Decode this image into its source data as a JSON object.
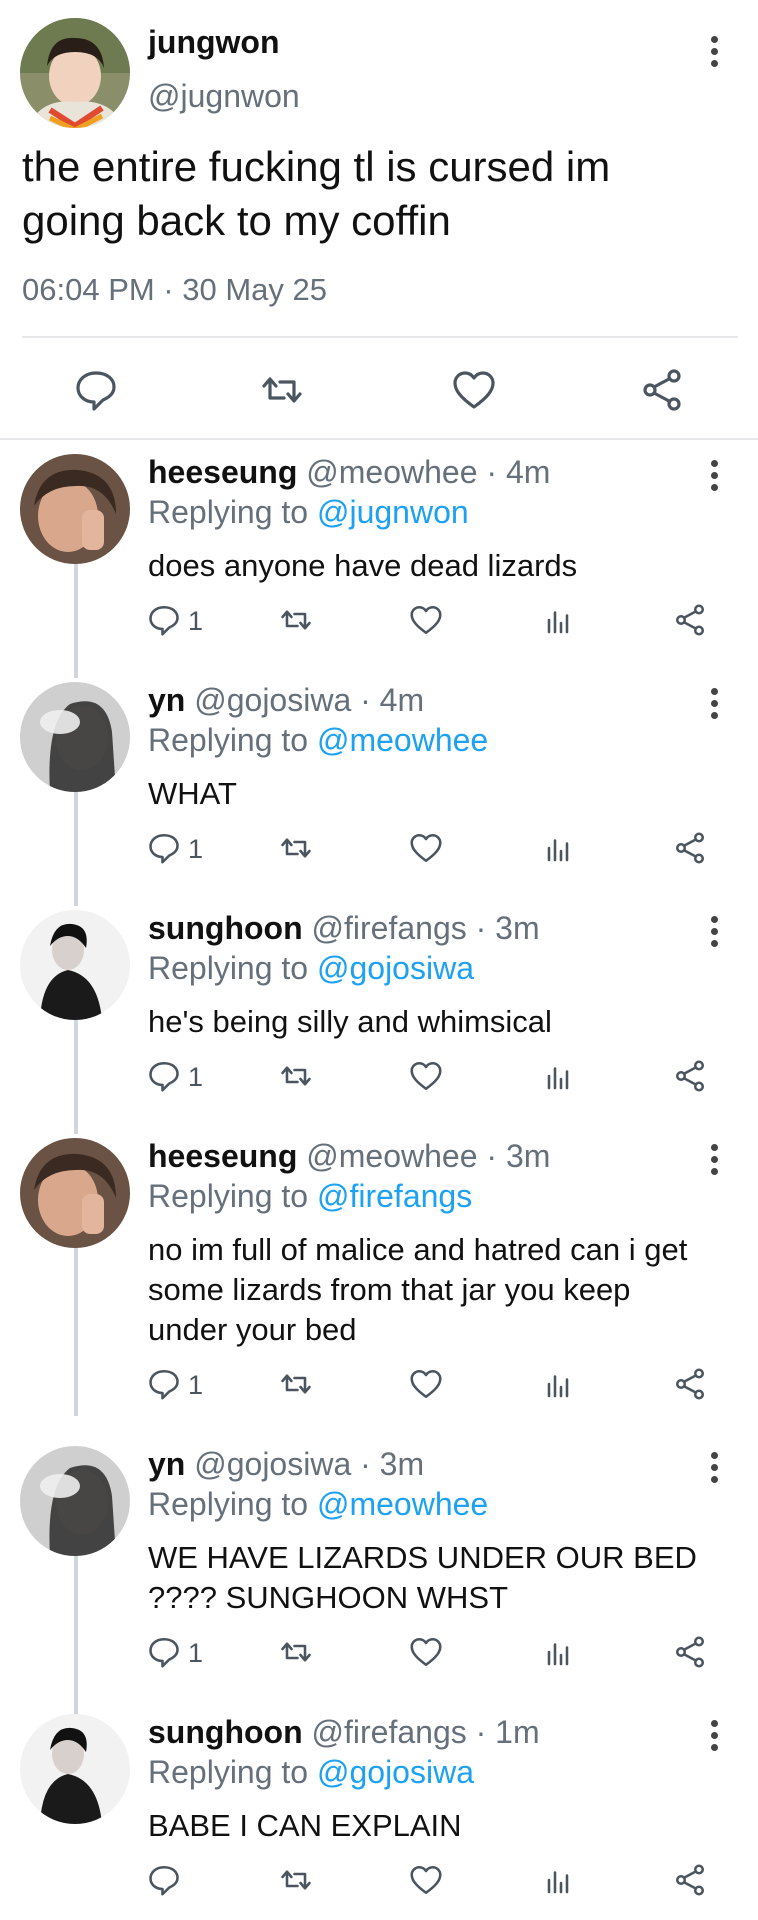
{
  "main_tweet": {
    "name": "jungwon",
    "handle": "@jugnwon",
    "text": "the entire fucking tl is cursed im going back to my coffin",
    "timestamp": "06:04 PM · 30 May 25",
    "actions": [
      "reply-icon",
      "retweet-icon",
      "like-icon",
      "share-icon"
    ]
  },
  "replies": [
    {
      "name": "heeseung",
      "handle": "@meowhee",
      "time": "· 4m",
      "replying_label": "Replying to",
      "replying_to": "@jugnwon",
      "text": "does anyone have dead lizards",
      "reply_count": "1"
    },
    {
      "name": "yn",
      "handle": "@gojosiwa",
      "time": "· 4m",
      "replying_label": "Replying to",
      "replying_to": "@meowhee",
      "text": "WHAT",
      "reply_count": "1"
    },
    {
      "name": "sunghoon",
      "handle": "@firefangs",
      "time": "· 3m",
      "replying_label": "Replying to",
      "replying_to": "@gojosiwa",
      "text": "he's being silly and whimsical",
      "reply_count": "1"
    },
    {
      "name": "heeseung",
      "handle": "@meowhee",
      "time": "· 3m",
      "replying_label": "Replying to",
      "replying_to": "@firefangs",
      "text": "no im full of malice and hatred can i get some lizards from that jar you keep under your bed",
      "reply_count": "1"
    },
    {
      "name": "yn",
      "handle": "@gojosiwa",
      "time": "· 3m",
      "replying_label": "Replying to",
      "replying_to": "@meowhee",
      "text": "WE HAVE LIZARDS UNDER OUR BED ???? SUNGHOON WHST",
      "reply_count": "1"
    },
    {
      "name": "sunghoon",
      "handle": "@firefangs",
      "time": "· 1m",
      "replying_label": "Replying to",
      "replying_to": "@gojosiwa",
      "text": "BABE I CAN EXPLAIN",
      "reply_count": ""
    }
  ],
  "colors": {
    "link": "#1da1f2",
    "muted": "#66707a",
    "divider": "#e6e8ea"
  }
}
